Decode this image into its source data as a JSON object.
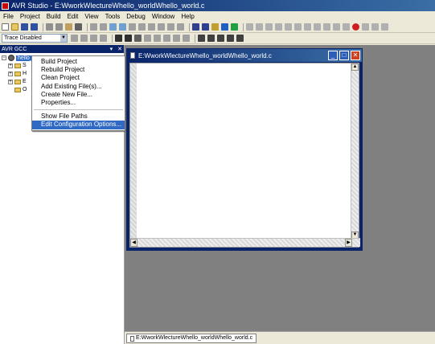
{
  "window": {
    "title": "AVR Studio - E:WworkWlectureWhello_worldWhello_world.c"
  },
  "menubar": {
    "items": [
      "File",
      "Project",
      "Build",
      "Edit",
      "View",
      "Tools",
      "Debug",
      "Window",
      "Help"
    ]
  },
  "toolbar": {
    "trace_select": "Trace Disabled"
  },
  "left_panel": {
    "title": "AVR GCC",
    "root_label": "hello_world",
    "tree_children": [
      "S",
      "H",
      "E",
      "O"
    ]
  },
  "context_menu": {
    "items": [
      "Build Project",
      "Rebuild Project",
      "Clean Project",
      "Add Existing File(s)...",
      "Create New File...",
      "Properties..."
    ],
    "items2": [
      "Show File Paths",
      "Edit Configuration Options..."
    ],
    "active": "Edit Configuration Options..."
  },
  "editor": {
    "title": "E:WworkWlectureWhello_worldWhello_world.c",
    "min_glyph": "_",
    "max_glyph": "□",
    "close_glyph": "✕"
  },
  "document_tab": {
    "label": "E:WworkWlectureWhello_worldWhello_world.c"
  },
  "colors": {
    "titlebar": "#0a246a",
    "accent": "#316ac5",
    "mdi_bg": "#808080"
  }
}
